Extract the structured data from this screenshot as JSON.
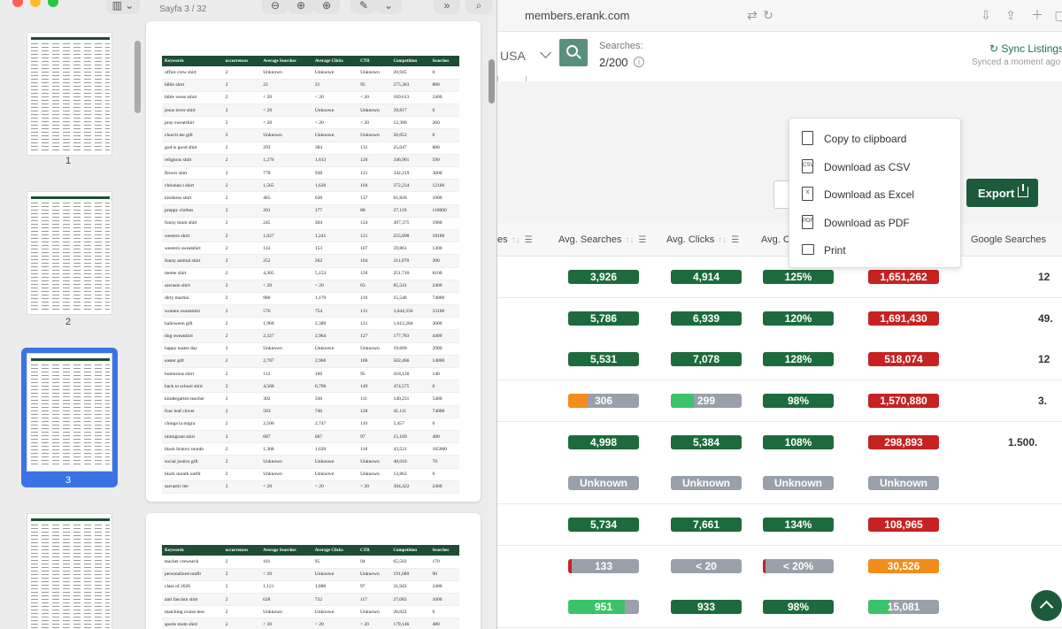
{
  "viewer": {
    "page_info": "Sayfa 3 / 32",
    "thumbnails": [
      {
        "label": "1"
      },
      {
        "label": "2"
      },
      {
        "label": "3"
      },
      {
        "label": ""
      }
    ],
    "table_headers": [
      "Keywords",
      "occurrences",
      "Average Searches",
      "Average Clicks",
      "CTR",
      "Competition",
      "Searches"
    ],
    "page3_rows": [
      [
        "office crew shirt",
        "2",
        "Unknown",
        "Unknown",
        "Unknown",
        "20,945",
        "0"
      ],
      [
        "bible shirt",
        "2",
        "22",
        "21",
        "95",
        "275,383",
        "880"
      ],
      [
        "bible verse tshirt",
        "2",
        "< 20",
        "< 20",
        "< 20",
        "169,613",
        "2400"
      ],
      [
        "jesus lover shirt",
        "2",
        "< 20",
        "Unknown",
        "Unknown",
        "39,817",
        "0"
      ],
      [
        "pray sweatshirt",
        "2",
        "< 20",
        "< 20",
        "< 20",
        "12,380",
        "260"
      ],
      [
        "church tee gift",
        "2",
        "Unknown",
        "Unknown",
        "Unknown",
        "50,052",
        "0"
      ],
      [
        "god is good shirt",
        "2",
        "293",
        "384",
        "131",
        "25,047",
        "880"
      ],
      [
        "religious shirt",
        "2",
        "1,276",
        "1,613",
        "126",
        "346,901",
        "590"
      ],
      [
        "flower shirt",
        "2",
        "778",
        "938",
        "121",
        "342,219",
        "3600"
      ],
      [
        "christian t shirt",
        "2",
        "1,565",
        "1,626",
        "104",
        "372,234",
        "12100"
      ],
      [
        "kindness shirt",
        "2",
        "465",
        "638",
        "137",
        "61,826",
        "1000"
      ],
      [
        "preppy clothes",
        "2",
        "201",
        "177",
        "88",
        "27,119",
        "110000"
      ],
      [
        "funny mom shirt",
        "2",
        "245",
        "304",
        "124",
        "497,375",
        "1900"
      ],
      [
        "western shirt",
        "2",
        "1,027",
        "1,241",
        "121",
        "255,898",
        "18100"
      ],
      [
        "western sweatshirt",
        "2",
        "143",
        "153",
        "107",
        "59,861",
        "1300"
      ],
      [
        "funny animal shirt",
        "2",
        "252",
        "262",
        "104",
        "311,078",
        "390"
      ],
      [
        "meme shirt",
        "2",
        "4,305",
        "5,153",
        "120",
        "251,710",
        "8100"
      ],
      [
        "sarcasm shirt",
        "2",
        "< 20",
        "< 20",
        "63",
        "85,541",
        "2400"
      ],
      [
        "dirty martini",
        "2",
        "980",
        "1,170",
        "119",
        "15,540",
        "74000"
      ],
      [
        "women sweatshirt",
        "2",
        "576",
        "754",
        "131",
        "3,644,356",
        "33100"
      ],
      [
        "halloween gift",
        "2",
        "1,968",
        "2,389",
        "121",
        "1,612,284",
        "3600"
      ],
      [
        "dog sweatshirt",
        "2",
        "2,327",
        "2,964",
        "127",
        "177,783",
        "4400"
      ],
      [
        "happy easter day",
        "2",
        "Unknown",
        "Unknown",
        "Unknown",
        "19,609",
        "2900"
      ],
      [
        "easter gift",
        "2",
        "2,787",
        "2,960",
        "106",
        "502,466",
        "14800"
      ],
      [
        "humorous shirt",
        "2",
        "112",
        "106",
        "95",
        "418,126",
        "140"
      ],
      [
        "back to school shirt",
        "2",
        "4,568",
        "6,796",
        "149",
        "474,575",
        "0"
      ],
      [
        "kindergarten teacher",
        "2",
        "302",
        "336",
        "111",
        "140,231",
        "5400"
      ],
      [
        "four leaf clover",
        "2",
        "583",
        "746",
        "128",
        "41,111",
        "74000"
      ],
      [
        "chinga la migra",
        "2",
        "2,506",
        "2,747",
        "110",
        "5,457",
        "0"
      ],
      [
        "immigrant shirt",
        "2",
        "687",
        "667",
        "97",
        "15,169",
        "480"
      ],
      [
        "black history month",
        "2",
        "1,368",
        "1,620",
        "118",
        "43,521",
        "165000"
      ],
      [
        "social justice gift",
        "2",
        "Unknown",
        "Unknown",
        "Unknown",
        "48,010",
        "70"
      ],
      [
        "black month outfit",
        "2",
        "Unknown",
        "Unknown",
        "Unknown",
        "13,863",
        "0"
      ],
      [
        "sarcastic tee",
        "2",
        "< 20",
        "< 20",
        "< 20",
        "304,422",
        "2400"
      ]
    ],
    "page4_rows": [
      [
        "teacher crewneck",
        "2",
        "101",
        "95",
        "94",
        "65,503",
        "170"
      ],
      [
        "personalized outfit",
        "2",
        "< 20",
        "Unknown",
        "Unknown",
        "191,680",
        "90"
      ],
      [
        "class of 2026",
        "2",
        "1,121",
        "1,088",
        "97",
        "31,943",
        "2400"
      ],
      [
        "anti fascism shirt",
        "2",
        "628",
        "732",
        "117",
        "27,083",
        "1000"
      ],
      [
        "matching cruise tees",
        "2",
        "Unknown",
        "Unknown",
        "Unknown",
        "28,822",
        "0"
      ],
      [
        "sports mom shirt",
        "2",
        "< 20",
        "< 20",
        "< 20",
        "179,146",
        "480"
      ]
    ]
  },
  "browser": {
    "url": "members.erank.com",
    "country": "USA",
    "searches_label": "Searches:",
    "searches_value": "2/200",
    "sync_label": "Sync Listings",
    "synced_text": "Synced a moment ago",
    "export_label": "Export",
    "columns": {
      "prev_partial": "es",
      "avg_searches": "Avg. Searches",
      "avg_clicks": "Avg. Clicks",
      "avg_ctr_partial": "Avg. C",
      "google_searches": "Google Searches"
    },
    "export_menu": [
      {
        "label": "Copy to clipboard",
        "icon": "copy-icon"
      },
      {
        "label": "Download as CSV",
        "icon": "csv-file-icon"
      },
      {
        "label": "Download as Excel",
        "icon": "excel-file-icon"
      },
      {
        "label": "Download as PDF",
        "icon": "pdf-file-icon"
      },
      {
        "label": "Print",
        "icon": "printer-icon"
      }
    ],
    "rows": [
      {
        "searches": "3,926",
        "s_fill": 1.0,
        "s_color": "#1d6b3c",
        "clicks": "4,914",
        "c_fill": 1.0,
        "c_color": "#1d6b3c",
        "ctr": "125%",
        "t_fill": 1.0,
        "t_color": "#1d6b3c",
        "competition": "1,651,262",
        "k_fill": 1.0,
        "k_color": "#c62222",
        "google": "12"
      },
      {
        "searches": "5,786",
        "s_fill": 1.0,
        "s_color": "#1d6b3c",
        "clicks": "6,939",
        "c_fill": 1.0,
        "c_color": "#1d6b3c",
        "ctr": "120%",
        "t_fill": 1.0,
        "t_color": "#1d6b3c",
        "competition": "1,691,430",
        "k_fill": 1.0,
        "k_color": "#c62222",
        "google": "49."
      },
      {
        "searches": "5,531",
        "s_fill": 1.0,
        "s_color": "#1d6b3c",
        "clicks": "7,078",
        "c_fill": 1.0,
        "c_color": "#1d6b3c",
        "ctr": "128%",
        "t_fill": 1.0,
        "t_color": "#1d6b3c",
        "competition": "518,074",
        "k_fill": 1.0,
        "k_color": "#c62222",
        "google": "12"
      },
      {
        "searches": "306",
        "s_fill": 0.28,
        "s_color": "#f28c1a",
        "clicks": "299",
        "c_fill": 0.32,
        "c_color": "#3cc36a",
        "ctr": "98%",
        "t_fill": 1.0,
        "t_color": "#1d6b3c",
        "competition": "1,570,880",
        "k_fill": 1.0,
        "k_color": "#c62222",
        "google": "3."
      },
      {
        "searches": "4,998",
        "s_fill": 1.0,
        "s_color": "#1d6b3c",
        "clicks": "5,384",
        "c_fill": 1.0,
        "c_color": "#1d6b3c",
        "ctr": "108%",
        "t_fill": 1.0,
        "t_color": "#1d6b3c",
        "competition": "298,893",
        "k_fill": 1.0,
        "k_color": "#c62222",
        "google": "1.500."
      },
      {
        "searches": "Unknown",
        "s_fill": 0,
        "s_color": "#9aa0aa",
        "clicks": "Unknown",
        "c_fill": 0,
        "c_color": "#9aa0aa",
        "ctr": "Unknown",
        "t_fill": 0,
        "t_color": "#9aa0aa",
        "competition": "Unknown",
        "k_fill": 0,
        "k_color": "#9aa0aa",
        "google": ""
      },
      {
        "searches": "5,734",
        "s_fill": 1.0,
        "s_color": "#1d6b3c",
        "clicks": "7,661",
        "c_fill": 1.0,
        "c_color": "#1d6b3c",
        "ctr": "134%",
        "t_fill": 1.0,
        "t_color": "#1d6b3c",
        "competition": "108,965",
        "k_fill": 1.0,
        "k_color": "#c62222",
        "google": ""
      },
      {
        "searches": "133",
        "s_fill": 0.05,
        "s_color": "#c62222",
        "clicks": "< 20",
        "c_fill": 0,
        "c_color": "#1d6b3c",
        "ctr": "< 20%",
        "t_fill": 0.04,
        "t_color": "#c62222",
        "competition": "30,526",
        "k_fill": 1.0,
        "k_color": "#f28c1a",
        "google": ""
      },
      {
        "searches": "951",
        "s_fill": 0.8,
        "s_color": "#3cc36a",
        "clicks": "933",
        "c_fill": 1.0,
        "c_color": "#1d6b3c",
        "ctr": "98%",
        "t_fill": 1.0,
        "t_color": "#1d6b3c",
        "competition": "15,081",
        "k_fill": 0.3,
        "k_color": "#3cc36a",
        "google": ""
      }
    ]
  }
}
